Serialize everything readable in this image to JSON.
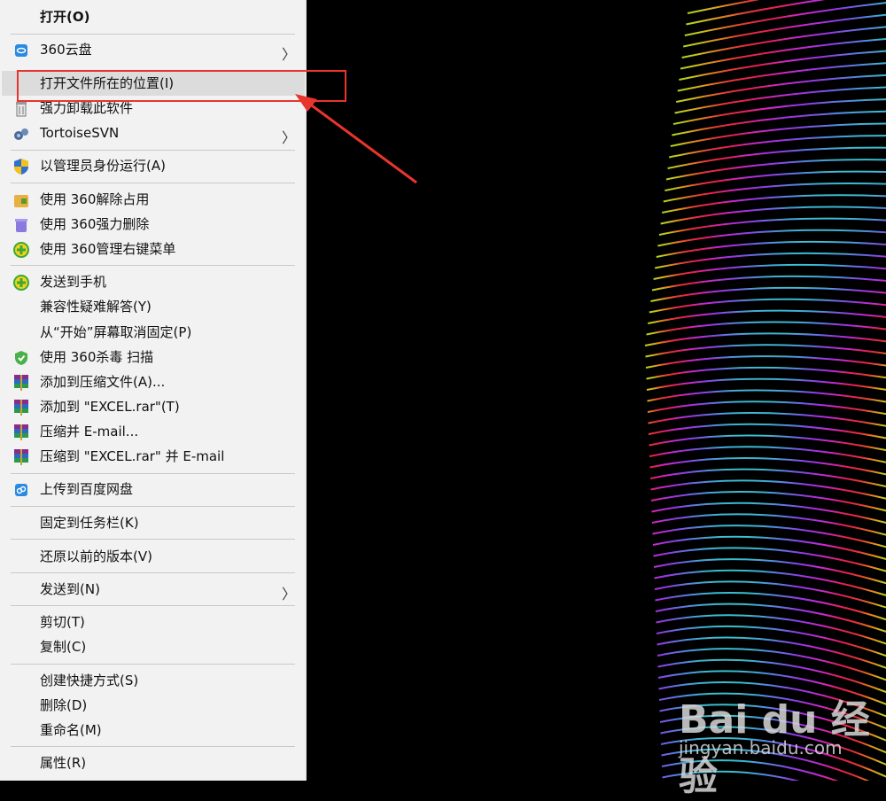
{
  "menu": {
    "items": [
      {
        "label": "打开(O)"
      },
      {
        "label": "360云盘"
      },
      {
        "label": "打开文件所在的位置(I)"
      },
      {
        "label": "强力卸载此软件"
      },
      {
        "label": "TortoiseSVN"
      },
      {
        "label": "以管理员身份运行(A)"
      },
      {
        "label": "使用 360解除占用"
      },
      {
        "label": "使用 360强力删除"
      },
      {
        "label": "使用 360管理右键菜单"
      },
      {
        "label": "发送到手机"
      },
      {
        "label": "兼容性疑难解答(Y)"
      },
      {
        "label": "从“开始”屏幕取消固定(P)"
      },
      {
        "label": "使用 360杀毒 扫描"
      },
      {
        "label": "添加到压缩文件(A)..."
      },
      {
        "label": "添加到 \"EXCEL.rar\"(T)"
      },
      {
        "label": "压缩并 E-mail..."
      },
      {
        "label": "压缩到 \"EXCEL.rar\" 并 E-mail"
      },
      {
        "label": "上传到百度网盘"
      },
      {
        "label": "固定到任务栏(K)"
      },
      {
        "label": "还原以前的版本(V)"
      },
      {
        "label": "发送到(N)"
      },
      {
        "label": "剪切(T)"
      },
      {
        "label": "复制(C)"
      },
      {
        "label": "创建快捷方式(S)"
      },
      {
        "label": "删除(D)"
      },
      {
        "label": "重命名(M)"
      },
      {
        "label": "属性(R)"
      }
    ],
    "submenu_arrow": "〉"
  },
  "watermark": {
    "brand": "Bai du 经验",
    "site": "jingyan.baidu.com"
  },
  "colors": {
    "highlight_box": "#e8352d",
    "menu_bg": "#f2f2f2"
  },
  "icons": [
    "cloud-360-icon",
    "uninstall-icon",
    "tortoisesvn-icon",
    "uac-shield-icon",
    "unlock-360-icon",
    "force-delete-icon",
    "menu-manage-icon",
    "send-to-phone-icon",
    "antivirus-icon",
    "winrar-icon",
    "baidu-netdisk-icon"
  ]
}
